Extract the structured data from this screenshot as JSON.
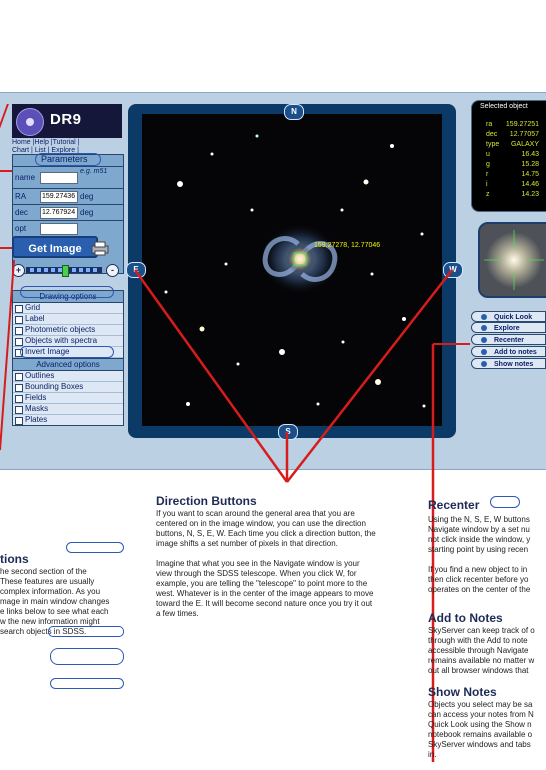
{
  "logo": {
    "title": "DR9"
  },
  "links": {
    "line1": "Home |Help |Tutorial |",
    "line2": "Chart | List | Explore |"
  },
  "parameters": {
    "title": "Parameters",
    "name_label": "name",
    "name_value": "",
    "name_hint": "e.g. m51",
    "ra_label": "RA",
    "ra_value": "159.27436",
    "ra_unit": "deg",
    "dec_label": "dec",
    "dec_value": "12.767924",
    "dec_unit": "deg",
    "opt_label": "opt",
    "opt_value": ""
  },
  "get_image_label": "Get Image",
  "zoom": {
    "minus": "+",
    "plus": "-",
    "level_fraction": 0.5
  },
  "drawing_options": {
    "title": "Drawing options",
    "items": [
      "Grid",
      "Label",
      "Photometric objects",
      "Objects with spectra",
      "Invert Image"
    ]
  },
  "advanced_options": {
    "title": "Advanced options",
    "items": [
      "Outlines",
      "Bounding Boxes",
      "Fields",
      "Masks",
      "Plates"
    ]
  },
  "directions": {
    "n": "N",
    "s": "S",
    "e": "E",
    "w": "W"
  },
  "image_label": "159.27278, 12.77046",
  "selected_object": {
    "title": "Selected object",
    "rows": [
      {
        "k": "ra",
        "v": "159.27251"
      },
      {
        "k": "dec",
        "v": "12.77057"
      },
      {
        "k": "type",
        "v": "GALAXY"
      },
      {
        "k": "u",
        "v": "16.43"
      },
      {
        "k": "g",
        "v": "15.28"
      },
      {
        "k": "r",
        "v": "14.75"
      },
      {
        "k": "i",
        "v": "14.46"
      },
      {
        "k": "z",
        "v": "14.23"
      }
    ]
  },
  "tool_buttons": [
    "Quick Look",
    "Explore",
    "Recenter",
    "Add to notes",
    "Show notes"
  ],
  "sections": {
    "direction": {
      "title": "Direction Buttons",
      "lines": [
        "If you want to scan around the general area that you are",
        "centered on in the image window, you can use the direction",
        "buttons, N, S, E, W. Each time you click a direction button, the",
        "image shifts a set number of pixels in that direction.",
        "",
        "Imagine that what you see in the Navigate window is your",
        "view through the SDSS telescope.  When you click W, for",
        "example, you are telling the \"telescope\" to point more to the",
        "west.  Whatever is in the center of the image appears to move",
        "toward the E.  It will become second nature once you try it out",
        "a few times."
      ]
    },
    "options_partial": {
      "title": "tions",
      "lines": [
        "he second section of the",
        "These features are usually",
        "complex information.  As you",
        "mage in main window changes",
        "e links below to see what each",
        "w the new information might",
        "search objects in SDSS."
      ]
    },
    "recenter": {
      "title": "Recenter",
      "lines": [
        "Using the N, S, E, W buttons",
        "Navigate window by a set nu",
        "not click inside the window, y",
        "starting point by using recen",
        "",
        "If you find a new object to in",
        "then click recenter before yo",
        "operates on the center of the"
      ]
    },
    "add_notes": {
      "title": "Add to Notes",
      "lines": [
        "SkyServer can keep track of o",
        "through with the Add to note",
        "accessible through Navigate",
        "remains available no matter w",
        "out all browser windows that"
      ]
    },
    "show_notes": {
      "title": "Show Notes",
      "lines": [
        "Objects you select may be sa",
        "can access your notes from N",
        "Quick Look using the Show n",
        "notebook remains available o",
        "SkyServer windows and tabs",
        "in."
      ]
    }
  }
}
